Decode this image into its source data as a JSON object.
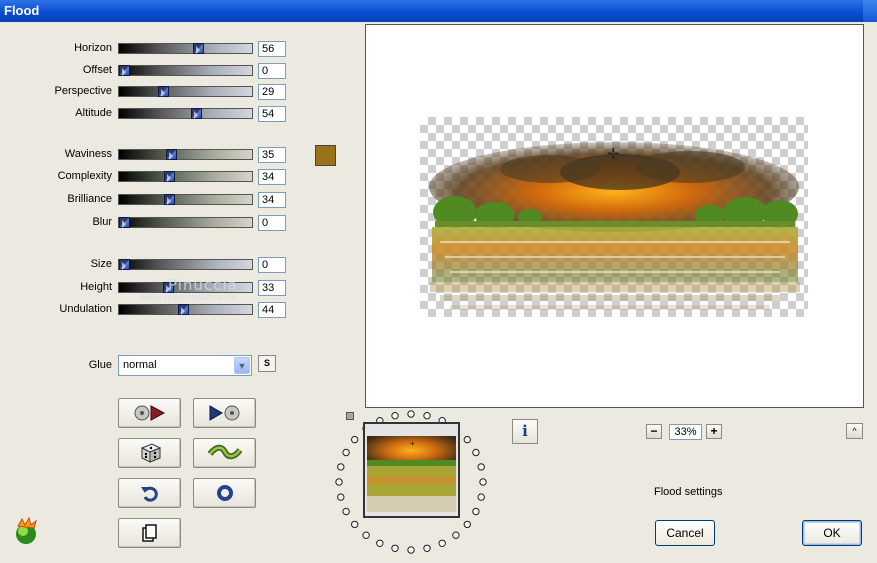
{
  "window": {
    "title": "Flood"
  },
  "sliders": [
    {
      "label": "Horizon",
      "value": "56",
      "track": "grey"
    },
    {
      "label": "Offset",
      "value": "0",
      "track": "grey"
    },
    {
      "label": "Perspective",
      "value": "29",
      "track": "grey"
    },
    {
      "label": "Altitude",
      "value": "54",
      "track": "grey"
    },
    {
      "label": "Waviness",
      "value": "35",
      "track": "khaki"
    },
    {
      "label": "Complexity",
      "value": "34",
      "track": "khaki"
    },
    {
      "label": "Brilliance",
      "value": "34",
      "track": "khaki"
    },
    {
      "label": "Blur",
      "value": "0",
      "track": "khaki"
    },
    {
      "label": "Size",
      "value": "0",
      "track": "grey"
    },
    {
      "label": "Height",
      "value": "33",
      "track": "grey"
    },
    {
      "label": "Undulation",
      "value": "44",
      "track": "grey"
    }
  ],
  "flood_color": "#9a7219",
  "watermark": {
    "line1": "Pinuccia",
    "line2": "www.magicgrafica.eu"
  },
  "glue": {
    "label": "Glue",
    "selected": "normal",
    "s_button": "S"
  },
  "tool_buttons": [
    {
      "name": "preset-load-icon"
    },
    {
      "name": "preset-save-icon"
    },
    {
      "name": "random-dice-icon"
    },
    {
      "name": "wave-icon"
    },
    {
      "name": "undo-icon"
    },
    {
      "name": "reset-icon"
    },
    {
      "name": "copy-icon"
    }
  ],
  "preview": {
    "zoom": "33%",
    "zoom_out": "−",
    "zoom_in": "+",
    "info": "i",
    "caret": "^"
  },
  "footer": {
    "settings_label": "Flood settings",
    "cancel_label": "Cancel",
    "ok_label": "OK"
  }
}
